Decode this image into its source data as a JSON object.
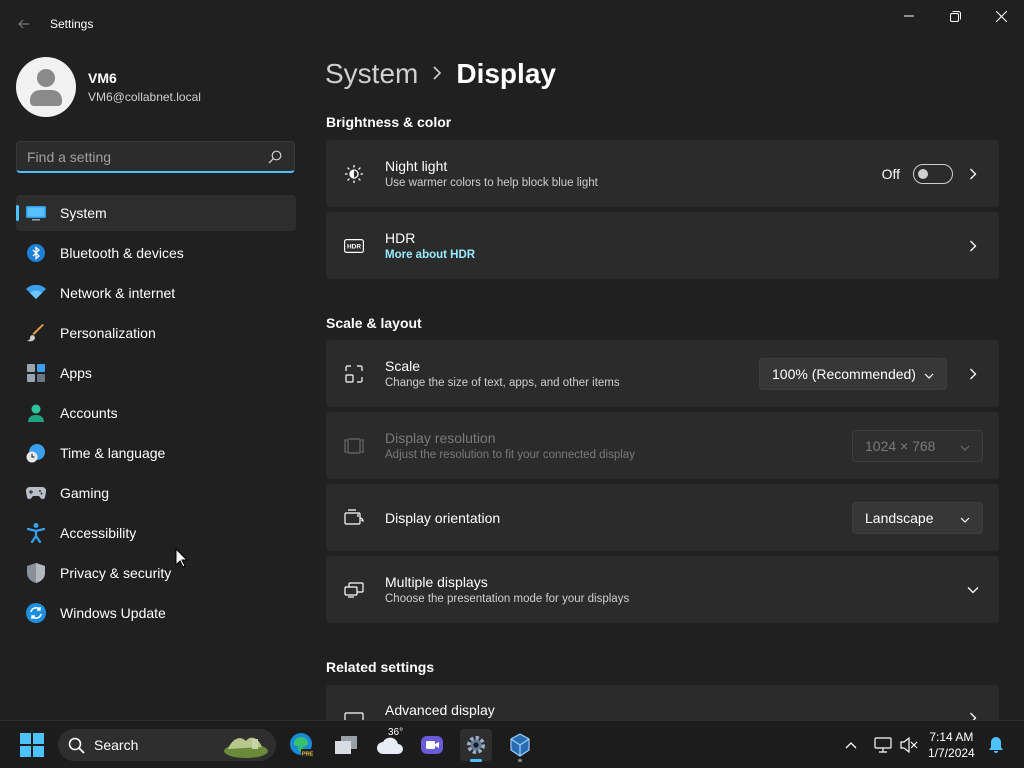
{
  "window": {
    "title": "Settings"
  },
  "profile": {
    "name": "VM6",
    "email": "VM6@collabnet.local"
  },
  "search": {
    "placeholder": "Find a setting",
    "value": ""
  },
  "nav": {
    "items": [
      {
        "label": "System",
        "icon": "system-icon",
        "active": true
      },
      {
        "label": "Bluetooth & devices",
        "icon": "bluetooth-icon"
      },
      {
        "label": "Network & internet",
        "icon": "wifi-icon"
      },
      {
        "label": "Personalization",
        "icon": "brush-icon"
      },
      {
        "label": "Apps",
        "icon": "apps-icon"
      },
      {
        "label": "Accounts",
        "icon": "accounts-icon"
      },
      {
        "label": "Time & language",
        "icon": "time-language-icon"
      },
      {
        "label": "Gaming",
        "icon": "gamepad-icon"
      },
      {
        "label": "Accessibility",
        "icon": "accessibility-icon"
      },
      {
        "label": "Privacy & security",
        "icon": "shield-icon"
      },
      {
        "label": "Windows Update",
        "icon": "update-icon"
      }
    ]
  },
  "breadcrumb": {
    "parent": "System",
    "current": "Display"
  },
  "sections": {
    "brightness": "Brightness & color",
    "scale_layout": "Scale & layout",
    "related": "Related settings"
  },
  "cards": {
    "night_light": {
      "title": "Night light",
      "subtitle": "Use warmer colors to help block blue light",
      "toggle_label": "Off",
      "toggle_on": false
    },
    "hdr": {
      "title": "HDR",
      "link": "More about HDR"
    },
    "scale": {
      "title": "Scale",
      "subtitle": "Change the size of text, apps, and other items",
      "value": "100% (Recommended)"
    },
    "resolution": {
      "title": "Display resolution",
      "subtitle": "Adjust the resolution to fit your connected display",
      "value": "1024 × 768",
      "disabled": true
    },
    "orientation": {
      "title": "Display orientation",
      "value": "Landscape"
    },
    "multiple": {
      "title": "Multiple displays",
      "subtitle": "Choose the presentation mode for your displays"
    },
    "advanced": {
      "title": "Advanced display"
    }
  },
  "taskbar": {
    "search_label": "Search",
    "weather_temp": "36°",
    "time": "7:14 AM",
    "date": "1/7/2024"
  },
  "colors": {
    "accent": "#4cc2ff",
    "link": "#99ebff",
    "background": "#202020",
    "card": "#2b2b2b"
  }
}
